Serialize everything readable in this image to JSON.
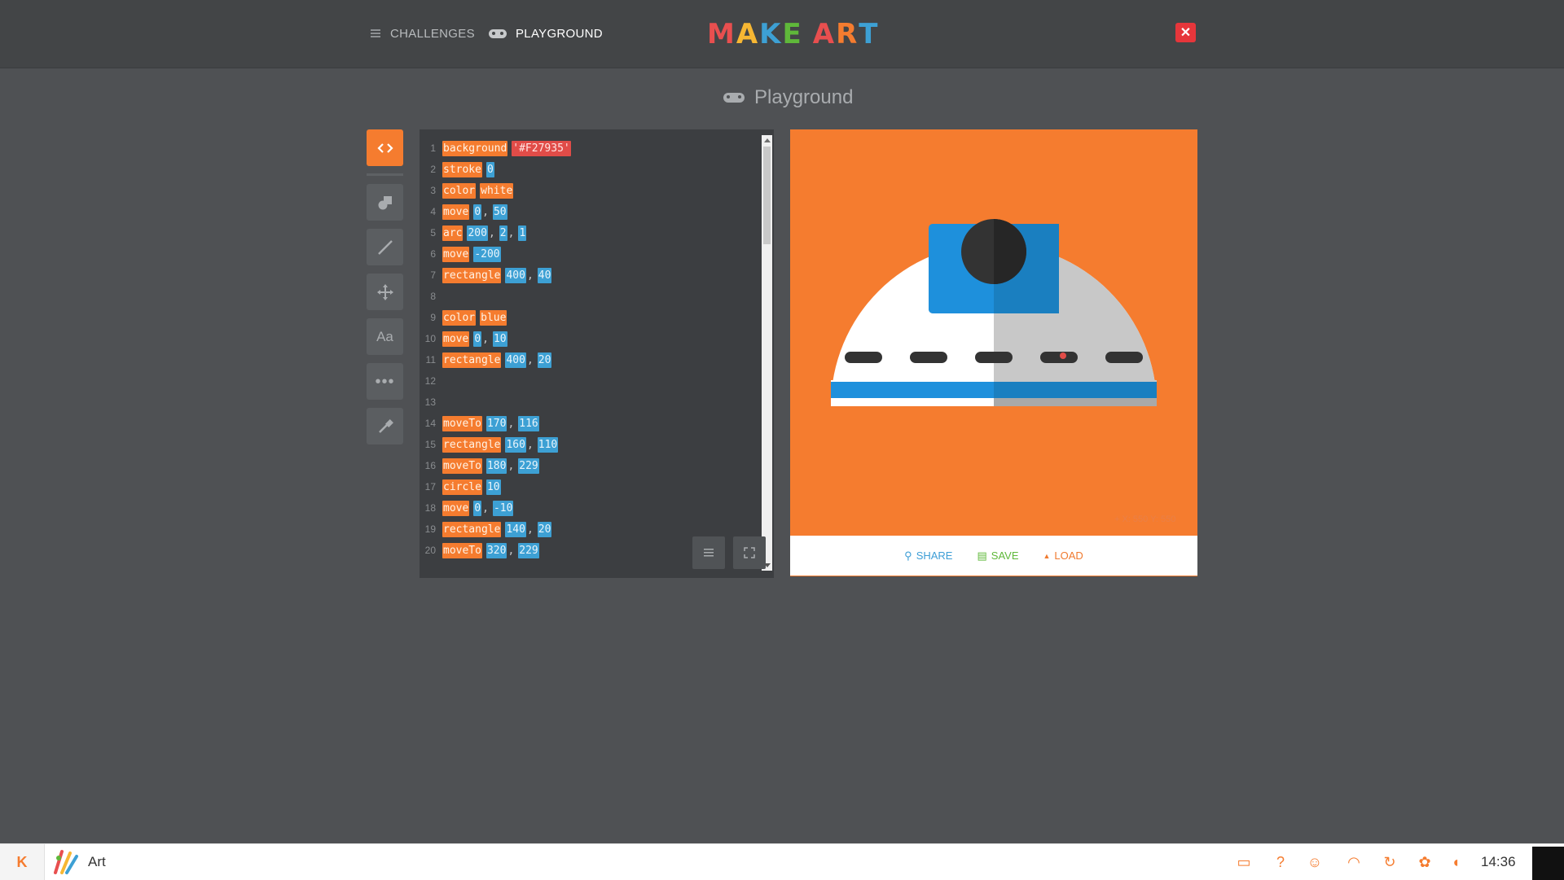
{
  "header": {
    "challenges_label": "CHALLENGES",
    "playground_label": "PLAYGROUND",
    "logo_letters": [
      "M",
      "A",
      "K",
      "E",
      "A",
      "R",
      "T"
    ],
    "logo_colors": [
      "#e84f4f",
      "#f7b733",
      "#3da0d4",
      "#5fb83a",
      "#e84f4f",
      "#f57c2f",
      "#3da0d4"
    ]
  },
  "page": {
    "title": "Playground"
  },
  "editor": {
    "lines": [
      {
        "n": "1",
        "tokens": [
          {
            "t": "cmd",
            "v": "background"
          },
          {
            "t": "str",
            "v": "'#F27935'"
          }
        ]
      },
      {
        "n": "2",
        "tokens": [
          {
            "t": "cmd",
            "v": "stroke"
          },
          {
            "t": "num",
            "v": "0"
          }
        ]
      },
      {
        "n": "3",
        "tokens": [
          {
            "t": "cmd",
            "v": "color"
          },
          {
            "t": "cmd",
            "v": "white"
          }
        ]
      },
      {
        "n": "4",
        "tokens": [
          {
            "t": "cmd",
            "v": "move"
          },
          {
            "t": "num",
            "v": "0"
          },
          {
            "t": "comma",
            "v": ","
          },
          {
            "t": "num",
            "v": "50"
          }
        ]
      },
      {
        "n": "5",
        "tokens": [
          {
            "t": "cmd",
            "v": "arc"
          },
          {
            "t": "num",
            "v": "200"
          },
          {
            "t": "comma",
            "v": ","
          },
          {
            "t": "num",
            "v": "2"
          },
          {
            "t": "comma",
            "v": ","
          },
          {
            "t": "num",
            "v": "1"
          }
        ]
      },
      {
        "n": "6",
        "tokens": [
          {
            "t": "cmd",
            "v": "move"
          },
          {
            "t": "num",
            "v": "-200"
          }
        ]
      },
      {
        "n": "7",
        "tokens": [
          {
            "t": "cmd",
            "v": "rectangle"
          },
          {
            "t": "num",
            "v": "400"
          },
          {
            "t": "comma",
            "v": ","
          },
          {
            "t": "num",
            "v": "40"
          }
        ]
      },
      {
        "n": "8",
        "tokens": []
      },
      {
        "n": "9",
        "tokens": [
          {
            "t": "cmd",
            "v": "color"
          },
          {
            "t": "cmd",
            "v": "blue"
          }
        ]
      },
      {
        "n": "10",
        "tokens": [
          {
            "t": "cmd",
            "v": "move"
          },
          {
            "t": "num",
            "v": "0"
          },
          {
            "t": "comma",
            "v": ","
          },
          {
            "t": "num",
            "v": "10"
          }
        ]
      },
      {
        "n": "11",
        "tokens": [
          {
            "t": "cmd",
            "v": "rectangle"
          },
          {
            "t": "num",
            "v": "400"
          },
          {
            "t": "comma",
            "v": ","
          },
          {
            "t": "num",
            "v": "20"
          }
        ]
      },
      {
        "n": "12",
        "tokens": []
      },
      {
        "n": "13",
        "tokens": []
      },
      {
        "n": "14",
        "tokens": [
          {
            "t": "cmd",
            "v": "moveTo"
          },
          {
            "t": "num",
            "v": "170"
          },
          {
            "t": "comma",
            "v": ","
          },
          {
            "t": "num",
            "v": "116"
          }
        ]
      },
      {
        "n": "15",
        "tokens": [
          {
            "t": "cmd",
            "v": "rectangle"
          },
          {
            "t": "num",
            "v": "160"
          },
          {
            "t": "comma",
            "v": ","
          },
          {
            "t": "num",
            "v": "110"
          }
        ]
      },
      {
        "n": "16",
        "tokens": [
          {
            "t": "cmd",
            "v": "moveTo"
          },
          {
            "t": "num",
            "v": "180"
          },
          {
            "t": "comma",
            "v": ","
          },
          {
            "t": "num",
            "v": "229"
          }
        ]
      },
      {
        "n": "17",
        "tokens": [
          {
            "t": "cmd",
            "v": "circle"
          },
          {
            "t": "num",
            "v": "10"
          }
        ]
      },
      {
        "n": "18",
        "tokens": [
          {
            "t": "cmd",
            "v": "move"
          },
          {
            "t": "num",
            "v": "0"
          },
          {
            "t": "comma",
            "v": ","
          },
          {
            "t": "num",
            "v": "-10"
          }
        ]
      },
      {
        "n": "19",
        "tokens": [
          {
            "t": "cmd",
            "v": "rectangle"
          },
          {
            "t": "num",
            "v": "140"
          },
          {
            "t": "comma",
            "v": ","
          },
          {
            "t": "num",
            "v": "20"
          }
        ]
      },
      {
        "n": "20",
        "tokens": [
          {
            "t": "cmd",
            "v": "moveTo"
          },
          {
            "t": "num",
            "v": "320"
          },
          {
            "t": "comma",
            "v": ","
          },
          {
            "t": "num",
            "v": "229"
          }
        ]
      }
    ]
  },
  "canvas": {
    "coords_label": "X: 550 Y: 550",
    "background": "#F27935"
  },
  "footer": {
    "share_label": "SHARE",
    "save_label": "SAVE",
    "load_label": "LOAD"
  },
  "taskbar": {
    "app_label": "Art",
    "clock": "14:36",
    "start_letter": "K",
    "tray_icons": [
      "screen-icon",
      "help-icon",
      "user-icon",
      "headphones-icon",
      "refresh-icon",
      "settings-icon",
      "volume-icon"
    ]
  },
  "colors": {
    "accent": "#f57c2f",
    "blue": "#3da0d4",
    "close_red": "#e6363b"
  }
}
